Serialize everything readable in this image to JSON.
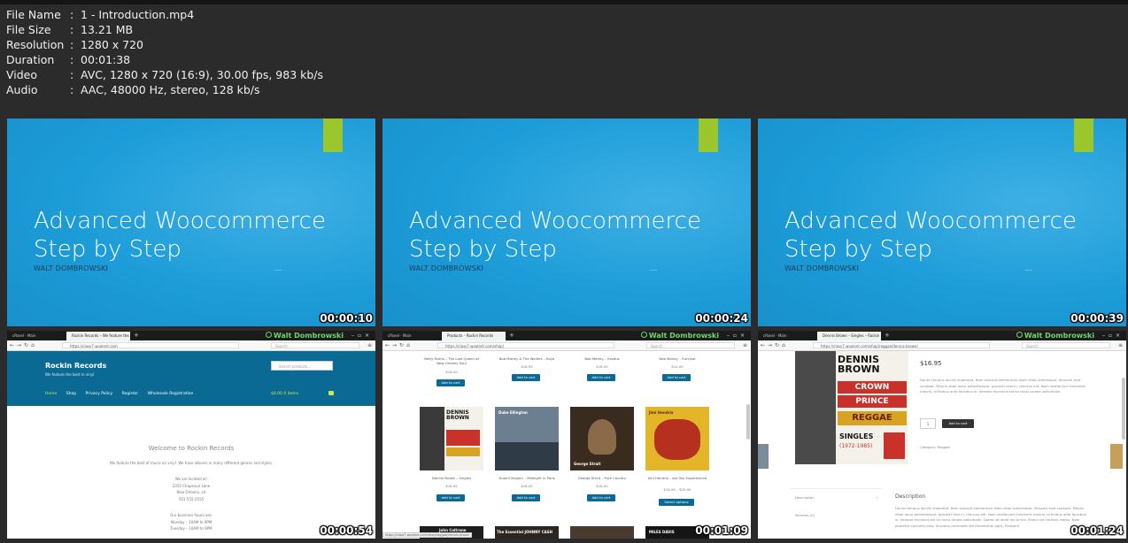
{
  "file_info": [
    {
      "key": "File Name",
      "value": "1 - Introduction.mp4"
    },
    {
      "key": "File Size",
      "value": "13.21 MB"
    },
    {
      "key": "Resolution",
      "value": "1280 x 720"
    },
    {
      "key": "Duration",
      "value": "00:01:38"
    },
    {
      "key": "Video",
      "value": "AVC, 1280 x 720 (16:9), 30.00 fps, 983 kb/s"
    },
    {
      "key": "Audio",
      "value": "AAC, 48000 Hz, stereo, 128 kb/s"
    }
  ],
  "separator": ":",
  "colors": {
    "slide_blue": "#1c9cd8",
    "slide_accent": "#9bc72d",
    "shop_header": "#0b6a94",
    "user_green": "#6fd46f"
  },
  "slide": {
    "title_line1": "Advanced Woocommerce",
    "title_line2": "Step by Step",
    "author": "WALT DOMBROWSKI"
  },
  "thumbnails": [
    {
      "timestamp": "00:00:10"
    },
    {
      "timestamp": "00:00:24"
    },
    {
      "timestamp": "00:00:39"
    },
    {
      "timestamp": "00:00:54"
    },
    {
      "timestamp": "00:01:09"
    },
    {
      "timestamp": "00:01:24"
    }
  ],
  "browser": {
    "user": "Walt Dombrowski",
    "search_placeholder": "Search"
  },
  "home": {
    "tabs": [
      "cPanel - Main",
      "Rockin Records – We feature the..."
    ],
    "url": "https://class7.woolent.com",
    "site_title": "Rockin Records",
    "tagline": "We feature the best in vinyl",
    "search": "Search products...",
    "nav": [
      "Home",
      "Shop",
      "Privacy Policy",
      "Register",
      "Wholesale Registration"
    ],
    "cart": "$0.00  0 items",
    "welcome": "Welcome to Rockin Records",
    "intro": "We feature the best of music on vinyl. We have albums in many different genres and styles.",
    "address": [
      "We are located at:",
      "2355 Chapeaux Lane",
      "New Orleans, LA",
      "501-555-5555"
    ],
    "hours": [
      "Our business hours are:",
      "Monday – 10AM to 9PM",
      "Tuesday – 10AM to 9PM"
    ]
  },
  "shop": {
    "tabs": [
      "cPanel - Main",
      "Products – Rockin Records"
    ],
    "url": "https://class7.woolent.com/shop/",
    "row1": [
      {
        "name": "Betty Harris – The Lost Queen of New Orleans Soul",
        "price": "$18.00"
      },
      {
        "name": "Bob Marley & The Wailers – Kaya",
        "price": "$16.95"
      },
      {
        "name": "Bob Marley – Exodus",
        "price": "$18.00"
      },
      {
        "name": "Bob Marley – Survival",
        "price": "$14.00"
      }
    ],
    "row2": [
      {
        "name": "Dennis Brown – Singles",
        "price": "$16.95",
        "button": "Add to cart"
      },
      {
        "name": "Duke Ellington – Midnight in Paris",
        "price": "$18.00",
        "button": "Add to cart"
      },
      {
        "name": "George Strait – Pure Country",
        "price": "$18.00",
        "button": "Add to cart"
      },
      {
        "name": "Jimi Hendrix – Are You Experienced",
        "price": "$14.00 – $20.00",
        "button": "Select options"
      }
    ],
    "add_to_cart": "Add to cart",
    "cover_labels": [
      "DENNIS BROWN",
      "Duke Ellington",
      "George Strait",
      "Jimi Hendrix"
    ],
    "bottom_labels": [
      "John Coltrane",
      "The Essential JOHNNY CASH",
      "",
      "MILES DAVIS"
    ],
    "status_url": "https://class7.woolent.com/shop/reggae/dennis-brown"
  },
  "single": {
    "tabs": [
      "cPanel - Main",
      "Dennis Brown – Singles – Rockin R..."
    ],
    "url": "https://class7.woolent.com/shop/reggae/dennis-brown/",
    "price": "$16.95",
    "desc": "Donec tempus iaculis imperdiet. Nam suscipit elementum diam vitae scelerisque. Aliquam erat volutpat. Mauris vitae lacus pellentesque, pulvinar erat in, rhoncus elit. Nam vestibulum hendrerit mauris, id finibus ante faucibus in. Aenean tincidunt est eu lacus ornare sollicitudin.",
    "qty": "1",
    "add_to_cart": "Add to cart",
    "category": "Category: Reggae",
    "cover_lines": [
      "DENNIS",
      "BROWN",
      "CROWN",
      "PRINCE",
      "REGGAE",
      "SINGLES",
      "(1972-1985)"
    ],
    "tabs_list": [
      "Description",
      "Reviews (0)"
    ],
    "desc_heading": "Description",
    "desc2": "Donec tempus iaculis imperdiet. Nam suscipit elementum diam vitae scelerisque. Aliquam erat volutpat. Mauris vitae lacus pellentesque, pulvinar erat in, rhoncus elit. Nam vestibulum hendrerit mauris, id finibus ante faucibus in. Aenean tincidunt est eu lacus ornare sollicitudin. Donec sit amet leo purus. Etiam nec facilisis metus. Nam pharetra convallis odio, faucibus commodo elit fermentum eget. Praesent"
  }
}
